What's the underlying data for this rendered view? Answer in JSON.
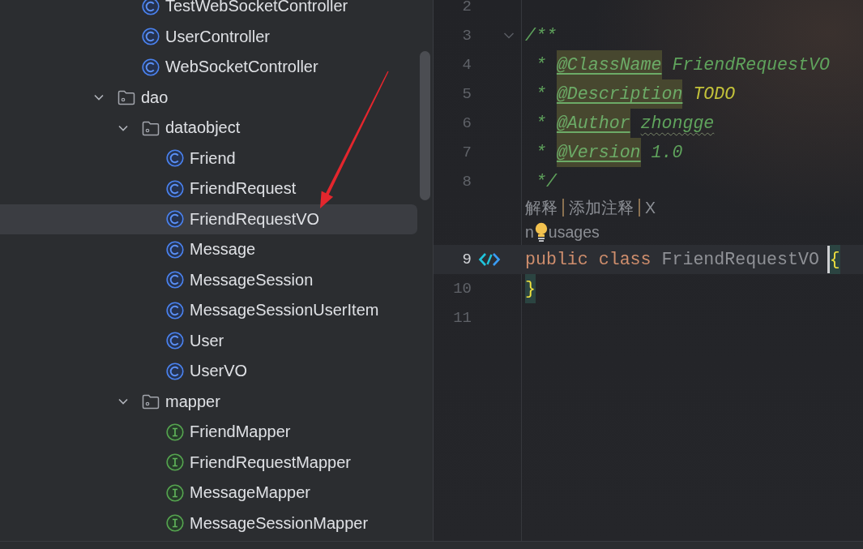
{
  "project_tree": {
    "items": [
      {
        "kind": "offscreen-package",
        "children": [
          {
            "kind": "class",
            "label": "TestWebSocketController",
            "selected": false
          },
          {
            "kind": "class",
            "label": "UserController",
            "selected": false
          },
          {
            "kind": "class",
            "label": "WebSocketController",
            "selected": false
          }
        ]
      },
      {
        "kind": "package",
        "label": "dao",
        "expanded": true,
        "selected": false,
        "children": [
          {
            "kind": "package",
            "label": "dataobject",
            "expanded": true,
            "selected": false,
            "children": [
              {
                "kind": "class",
                "label": "Friend",
                "selected": false
              },
              {
                "kind": "class",
                "label": "FriendRequest",
                "selected": false
              },
              {
                "kind": "class",
                "label": "FriendRequestVO",
                "selected": true
              },
              {
                "kind": "class",
                "label": "Message",
                "selected": false
              },
              {
                "kind": "class",
                "label": "MessageSession",
                "selected": false
              },
              {
                "kind": "class",
                "label": "MessageSessionUserItem",
                "selected": false
              },
              {
                "kind": "class",
                "label": "User",
                "selected": false
              },
              {
                "kind": "class",
                "label": "UserVO",
                "selected": false
              }
            ]
          },
          {
            "kind": "package",
            "label": "mapper",
            "expanded": true,
            "selected": false,
            "children": [
              {
                "kind": "interface",
                "label": "FriendMapper",
                "selected": false
              },
              {
                "kind": "interface",
                "label": "FriendRequestMapper",
                "selected": false
              },
              {
                "kind": "interface",
                "label": "MessageMapper",
                "selected": false
              },
              {
                "kind": "interface",
                "label": "MessageSessionMapper",
                "selected": false
              }
            ]
          }
        ]
      }
    ]
  },
  "editor": {
    "lines": [
      {
        "kind": "code",
        "number": "2",
        "current": false
      },
      {
        "kind": "code",
        "number": "3",
        "current": false,
        "gutter_marker": {
          "kind": "fold"
        },
        "tokens": [
          {
            "text": "/**",
            "kind": "comment"
          }
        ]
      },
      {
        "kind": "code",
        "number": "4",
        "current": false,
        "tokens": [
          {
            "text": " * ",
            "kind": "comment"
          },
          {
            "text": "@ClassName",
            "kind": "doc-tag"
          },
          {
            "text": " FriendRequestVO",
            "kind": "comment"
          }
        ]
      },
      {
        "kind": "code",
        "number": "5",
        "current": false,
        "tokens": [
          {
            "text": " * ",
            "kind": "comment"
          },
          {
            "text": "@Description",
            "kind": "doc-tag"
          },
          {
            "text": " TODO",
            "kind": "todo"
          }
        ]
      },
      {
        "kind": "code",
        "number": "6",
        "current": false,
        "tokens": [
          {
            "text": " * ",
            "kind": "comment"
          },
          {
            "text": "@Author",
            "kind": "doc-tag"
          },
          {
            "text": " zhongge",
            "kind": "typo"
          }
        ]
      },
      {
        "kind": "code",
        "number": "7",
        "current": false,
        "tokens": [
          {
            "text": " * ",
            "kind": "comment"
          },
          {
            "text": "@Version",
            "kind": "doc-tag"
          },
          {
            "text": " 1.0",
            "kind": "comment"
          }
        ]
      },
      {
        "kind": "code",
        "number": "8",
        "current": false,
        "tokens": [
          {
            "text": " */",
            "kind": "comment"
          }
        ]
      },
      {
        "kind": "inlay-actions",
        "actions": [
          "解释",
          "添加注释",
          "X"
        ]
      },
      {
        "kind": "inlay-usages",
        "text_before_bulb": "n",
        "text_after_bulb": "usages"
      },
      {
        "kind": "code",
        "number": "9",
        "current": true,
        "gutter_marker": {
          "kind": "implementation"
        },
        "tokens": [
          {
            "text": "public",
            "kind": "keyword"
          },
          {
            "text": " class",
            "kind": "keyword"
          },
          {
            "text": " FriendRequestVO ",
            "kind": "unused-name"
          },
          {
            "kind": "caret"
          },
          {
            "text": "{",
            "kind": "brace-match"
          }
        ]
      },
      {
        "kind": "code",
        "number": "10",
        "current": false,
        "tokens": [
          {
            "text": "}",
            "kind": "brace-match"
          }
        ]
      },
      {
        "kind": "code",
        "number": "11",
        "current": false
      }
    ]
  },
  "annotation": {
    "kind": "arrow"
  }
}
